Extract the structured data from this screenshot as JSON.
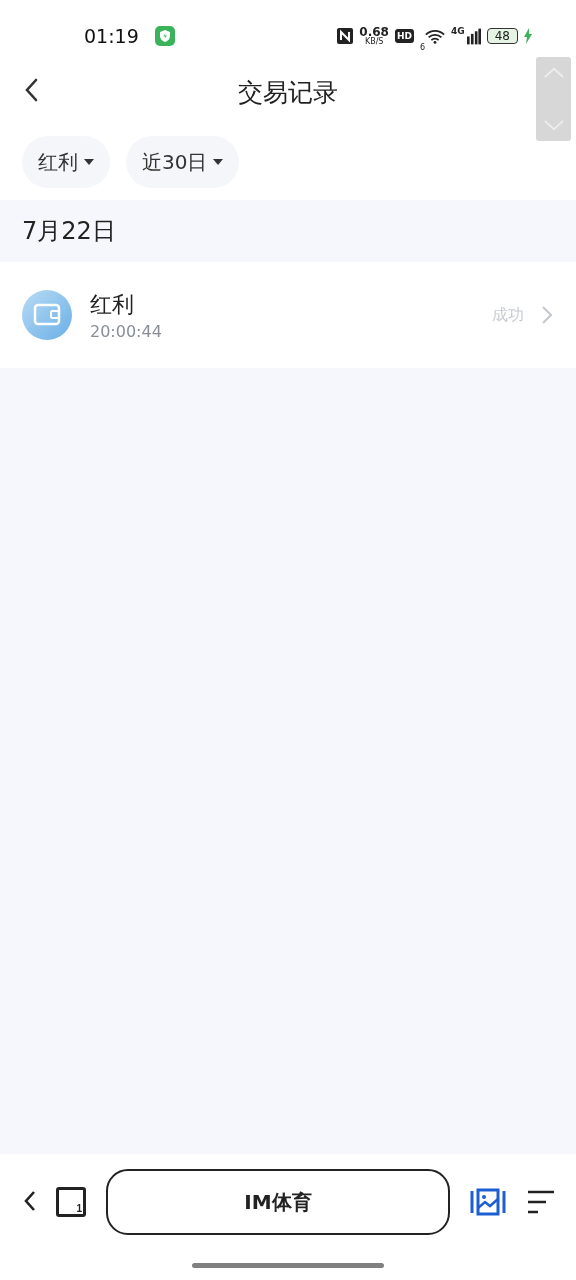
{
  "status_bar": {
    "time": "01:19",
    "net_speed": "0.68",
    "net_unit": "KB/S",
    "hd": "HD",
    "wifi_label": "6",
    "network": "4G",
    "battery": "48",
    "charging": true
  },
  "header": {
    "title": "交易记录"
  },
  "filters": [
    {
      "label": "红利"
    },
    {
      "label": "近30日"
    }
  ],
  "groups": [
    {
      "date": "7月22日",
      "records": [
        {
          "title": "红利",
          "time": "20:00:44",
          "status": "成功"
        }
      ]
    }
  ],
  "browser_bar": {
    "tab_count": "1",
    "address": "IM体育"
  }
}
